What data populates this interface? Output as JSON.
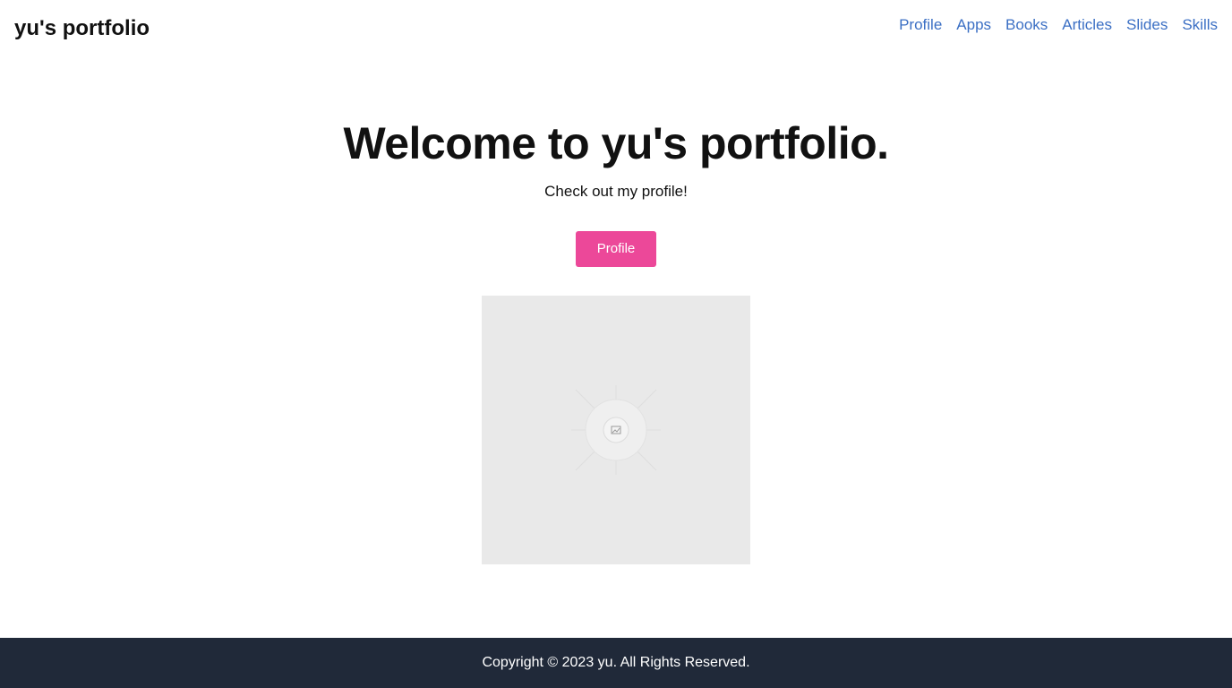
{
  "header": {
    "brand": "yu's portfolio",
    "nav": [
      "Profile",
      "Apps",
      "Books",
      "Articles",
      "Slides",
      "Skills"
    ]
  },
  "hero": {
    "title": "Welcome to yu's portfolio.",
    "subtitle": "Check out my profile!",
    "cta_label": "Profile"
  },
  "image": {
    "icon": "image-icon"
  },
  "footer": {
    "copyright": "Copyright © 2023 yu. All Rights Reserved."
  },
  "colors": {
    "link": "#3b6fc4",
    "accent": "#ec4899",
    "footer_bg": "#202939",
    "placeholder_bg": "#e9e9e9"
  }
}
